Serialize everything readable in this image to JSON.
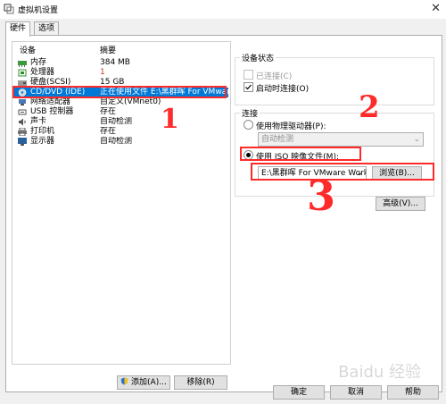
{
  "window": {
    "title": "虚拟机设置"
  },
  "tabs": [
    {
      "label": "硬件"
    },
    {
      "label": "选项"
    }
  ],
  "device_list": {
    "header": {
      "device": "设备",
      "summary": "摘要"
    },
    "items": [
      {
        "name": "内存",
        "summary": "384 MB",
        "icon": "memory-icon"
      },
      {
        "name": "处理器",
        "summary": "1",
        "icon": "cpu-icon"
      },
      {
        "name": "硬盘(SCSI)",
        "summary": "15 GB",
        "icon": "harddisk-icon"
      },
      {
        "name": "CD/DVD (IDE)",
        "summary": "正在使用文件 E:\\黑群晖 For VMware...",
        "icon": "cd-dvd-icon",
        "selected": true
      },
      {
        "name": "网络适配器",
        "summary": "自定义(VMnet0)",
        "icon": "network-icon"
      },
      {
        "name": "USB 控制器",
        "summary": "存在",
        "icon": "usb-icon"
      },
      {
        "name": "声卡",
        "summary": "自动检测",
        "icon": "sound-icon"
      },
      {
        "name": "打印机",
        "summary": "存在",
        "icon": "printer-icon"
      },
      {
        "name": "显示器",
        "summary": "自动检测",
        "icon": "display-icon"
      }
    ]
  },
  "device_status": {
    "title": "设备状态",
    "connected_label": "已连接(C)",
    "connect_on_power_label": "启动时连接(O)",
    "connect_on_power_checked": true
  },
  "connection": {
    "title": "连接",
    "physical_label": "使用物理驱动器(P):",
    "physical_value": "自动检测",
    "iso_label": "使用 ISO 映像文件(M):",
    "iso_value": "E:\\黑群晖 For VMware Work",
    "browse_label": "浏览(B)...",
    "advanced_label": "高级(V)..."
  },
  "bottom_buttons": {
    "add": "添加(A)...",
    "remove": "移除(R)"
  },
  "footer_buttons": {
    "ok": "确定",
    "cancel": "取消",
    "help": "帮助"
  },
  "annotations": [
    "1",
    "2",
    "3"
  ],
  "watermark": "Baidu 经验",
  "colors": {
    "selection": "#0078d7",
    "annotation_red": "#ff2a2a"
  }
}
